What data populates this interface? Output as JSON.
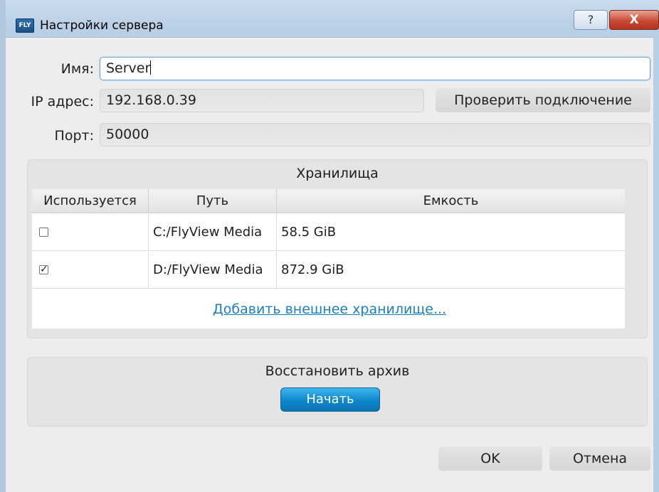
{
  "window": {
    "icon_text": "FLY",
    "title": "Настройки сервера",
    "help_label": "?",
    "close_label": "X"
  },
  "form": {
    "name_label": "Имя:",
    "name_value": "Server",
    "ip_label": "IP адрес:",
    "ip_value": "192.168.0.39",
    "check_connection_label": "Проверить подключение",
    "port_label": "Порт:",
    "port_value": "50000"
  },
  "storage": {
    "title": "Хранилища",
    "columns": [
      "Используется",
      "Путь",
      "Емкость"
    ],
    "rows": [
      {
        "used": false,
        "path": "C:/FlyView Media",
        "capacity": "58.5 GiB"
      },
      {
        "used": true,
        "path": "D:/FlyView Media",
        "capacity": "872.9 GiB"
      }
    ],
    "add_link": "Добавить внешнее хранилище..."
  },
  "restore": {
    "title": "Восстановить архив",
    "start_label": "Начать"
  },
  "footer": {
    "ok_label": "OK",
    "cancel_label": "Отмена"
  },
  "colors": {
    "titlebar": "#b9cfe6",
    "client_bg": "#ededed",
    "accent_blue": "#0e86cc",
    "close_red": "#c94a35",
    "link": "#1a7fc1"
  }
}
